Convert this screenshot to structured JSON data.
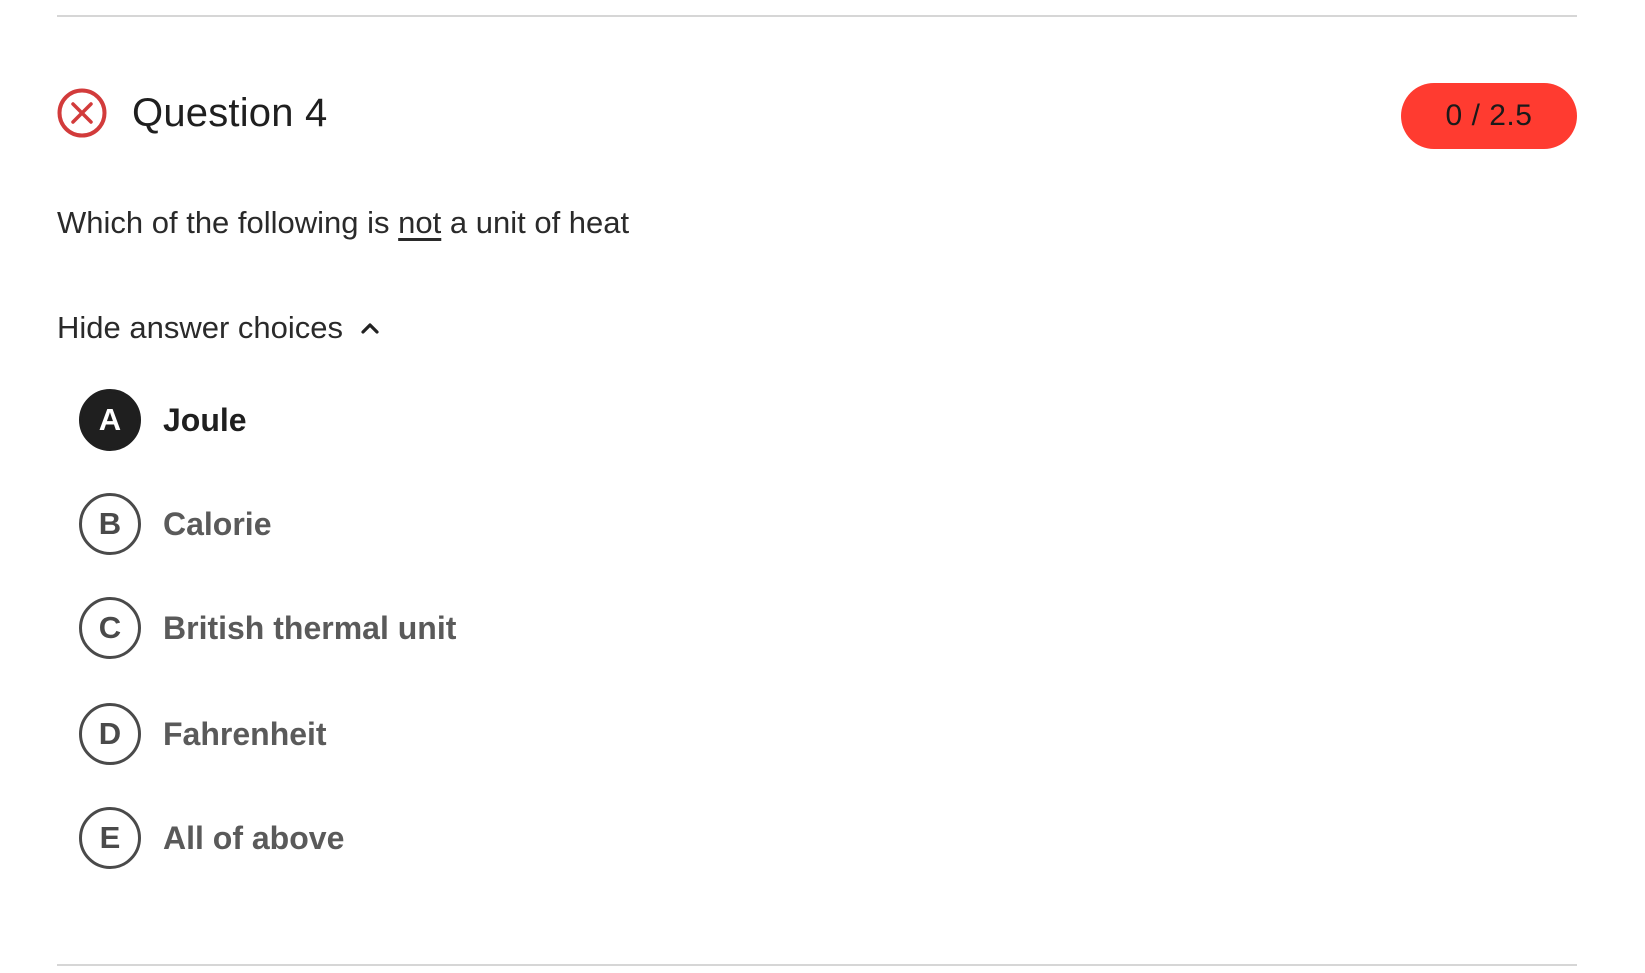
{
  "question": {
    "title": "Question 4",
    "status": "incorrect",
    "score_label": "0 / 2.5",
    "prompt_before": "Which of the following is ",
    "prompt_emphasis": "not",
    "prompt_after": " a unit of heat"
  },
  "answers_toggle": {
    "label": "Hide answer choices",
    "icon": "chevron-up-icon"
  },
  "choices": [
    {
      "letter": "A",
      "text": "Joule",
      "selected": true
    },
    {
      "letter": "B",
      "text": "Calorie",
      "selected": false
    },
    {
      "letter": "C",
      "text": "British thermal unit",
      "selected": false
    },
    {
      "letter": "D",
      "text": "Fahrenheit",
      "selected": false
    },
    {
      "letter": "E",
      "text": "All of above",
      "selected": false
    }
  ],
  "colors": {
    "incorrect_icon": "#d23b3b",
    "score_badge_bg": "#ff3b30",
    "selected_letter_bg": "#1f1f1f",
    "letter_border": "#4a4a4a"
  }
}
